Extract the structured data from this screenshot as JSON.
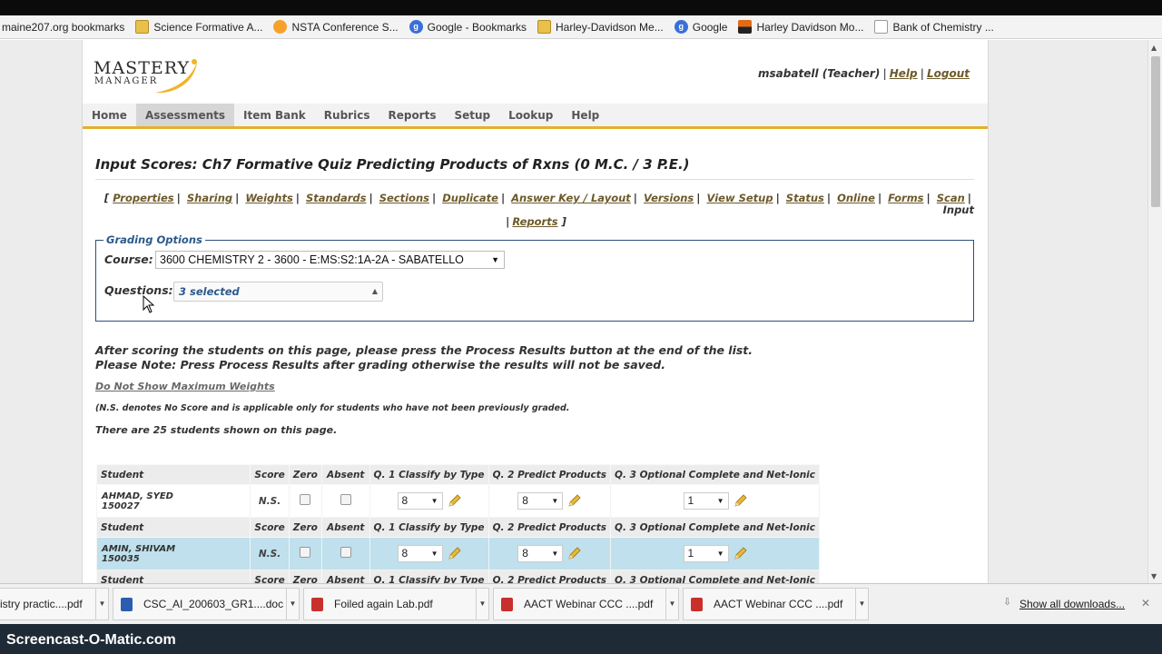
{
  "bookmarks": [
    {
      "label": "maine207.org bookmarks",
      "icon": "none"
    },
    {
      "label": "Science Formative A...",
      "icon": "folder-icon"
    },
    {
      "label": "NSTA Conference S...",
      "icon": "nsta-icon"
    },
    {
      "label": "Google - Bookmarks",
      "icon": "google-icon"
    },
    {
      "label": "Harley-Davidson Me...",
      "icon": "folder-icon"
    },
    {
      "label": "Google",
      "icon": "google-icon"
    },
    {
      "label": "Harley Davidson Mo...",
      "icon": "harley-icon"
    },
    {
      "label": "Bank of Chemistry ...",
      "icon": "page-icon"
    }
  ],
  "header": {
    "logo_word": "MASTERY",
    "logo_sub": "MANAGER",
    "user": "msabatell (Teacher)",
    "help": "Help",
    "logout": "Logout"
  },
  "nav": [
    {
      "label": "Home",
      "active": false
    },
    {
      "label": "Assessments",
      "active": true
    },
    {
      "label": "Item Bank",
      "active": false
    },
    {
      "label": "Rubrics",
      "active": false
    },
    {
      "label": "Reports",
      "active": false
    },
    {
      "label": "Setup",
      "active": false
    },
    {
      "label": "Lookup",
      "active": false
    },
    {
      "label": "Help",
      "active": false
    }
  ],
  "title": "Input Scores: Ch7 Formative Quiz Predicting Products of Rxns (0 M.C. / 3 P.E.)",
  "sublinks": {
    "line1": [
      "Properties",
      "Sharing",
      "Weights",
      "Standards",
      "Sections",
      "Duplicate",
      "Answer Key / Layout",
      "Versions",
      "View Setup",
      "Status",
      "Online",
      "Forms",
      "Scan"
    ],
    "current": "Input",
    "line2": [
      "Reports"
    ],
    "open": "[",
    "close": "]"
  },
  "grading": {
    "legend": "Grading Options",
    "course_label": "Course:",
    "course_value": "3600 CHEMISTRY 2 - 3600 - E:MS:S2:1A-2A - SABATELLO",
    "questions_label": "Questions:",
    "questions_value": "3 selected"
  },
  "instructions": {
    "line1": "After scoring the students on this page, please press the Process Results button at the end of the list.",
    "line2": "Please Note: Press Process Results after grading otherwise the results will not be saved.",
    "max_weights_link": "Do Not Show Maximum Weights",
    "ns_note": "(N.S. denotes No Score and is applicable only for students who have not been previously graded.",
    "count": "There are 25 students shown on this page."
  },
  "table": {
    "headers": [
      "Student",
      "Score",
      "Zero",
      "Absent",
      "Q. 1 Classify by Type",
      "Q. 2 Predict Products",
      "Q. 3 Optional Complete and Net-Ionic"
    ],
    "rows": [
      {
        "name": "AHMAD, SYED",
        "id": "150027",
        "score": "N.S.",
        "q1": "8",
        "q2": "8",
        "q3": "1",
        "highlight": false
      },
      {
        "name": "AMIN, SHIVAM",
        "id": "150035",
        "score": "N.S.",
        "q1": "8",
        "q2": "8",
        "q3": "1",
        "highlight": true
      }
    ]
  },
  "downloads": {
    "items": [
      {
        "label": "istry practic....pdf",
        "type": "pdf"
      },
      {
        "label": "CSC_AI_200603_GR1....doc",
        "type": "doc"
      },
      {
        "label": "Foiled again Lab.pdf",
        "type": "pdf"
      },
      {
        "label": "AACT Webinar CCC ....pdf",
        "type": "pdf"
      },
      {
        "label": "AACT Webinar CCC ....pdf",
        "type": "pdf"
      }
    ],
    "show_all": "Show all downloads..."
  },
  "watermark": "Screencast-O-Matic.com",
  "colors": {
    "accent_gold": "#e3b12a",
    "link_brown": "#6d5a2a",
    "legend_blue": "#2c5a8c",
    "row_highlight": "#bfe0ec"
  }
}
